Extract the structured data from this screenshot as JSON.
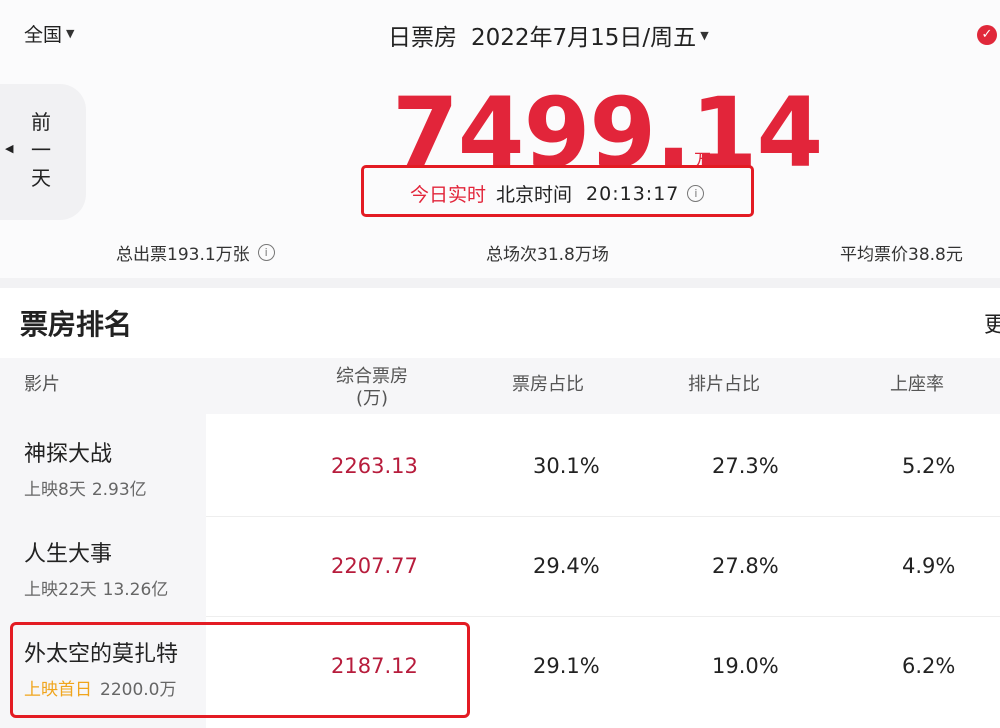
{
  "header": {
    "region": "全国",
    "title": "日票房",
    "date": "2022年7月15日/周五",
    "share_badge": "✓"
  },
  "prev_day": {
    "chars": [
      "前",
      "一",
      "天"
    ]
  },
  "summary": {
    "total": "7499.14",
    "unit": "万",
    "realtime_label": "今日实时",
    "timezone": "北京时间",
    "time": "20:13:17",
    "tickets": "总出票193.1万张",
    "shows": "总场次31.8万场",
    "avg_price": "平均票价38.8元"
  },
  "ranking": {
    "title": "票房排名",
    "more": "更",
    "columns": {
      "film": "影片",
      "box_line1": "综合票房",
      "box_line2": "(万)",
      "share": "票房占比",
      "seat": "排片占比",
      "occupancy": "上座率"
    },
    "rows": [
      {
        "title": "神探大战",
        "sub_days": "上映8天",
        "sub_total": "2.93亿",
        "box": "2263.13",
        "share": "30.1%",
        "seat": "27.3%",
        "occupancy": "5.2%"
      },
      {
        "title": "人生大事",
        "sub_days": "上映22天",
        "sub_total": "13.26亿",
        "box": "2207.77",
        "share": "29.4%",
        "seat": "27.8%",
        "occupancy": "4.9%"
      },
      {
        "title": "外太空的莫扎特",
        "sub_days": "上映首日",
        "sub_total": "2200.0万",
        "box": "2187.12",
        "share": "29.1%",
        "seat": "19.0%",
        "occupancy": "6.2%"
      }
    ]
  },
  "colors": {
    "accent": "#e2253a",
    "highlight_orange": "#f0a51d",
    "box_value": "#b71c3c"
  }
}
